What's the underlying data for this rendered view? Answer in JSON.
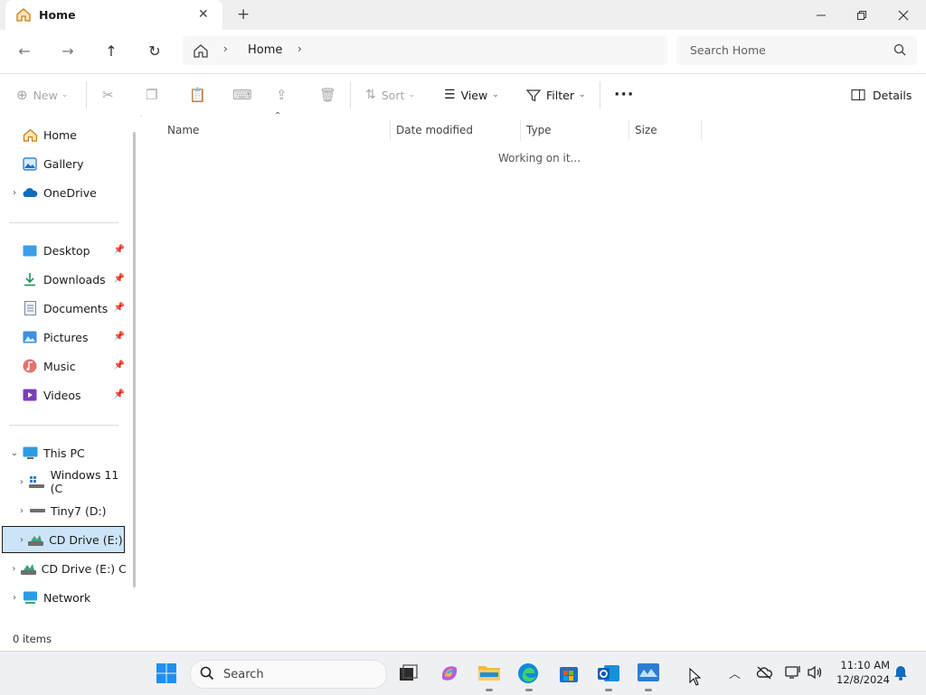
{
  "window": {
    "tab_title": "Home",
    "new_tab_icon": "plus-icon",
    "controls": [
      "minimize-icon",
      "restore-icon",
      "close-icon"
    ]
  },
  "nav": {
    "breadcrumb": [
      "Home"
    ],
    "search_placeholder": "Search Home"
  },
  "commandbar": {
    "new_label": "New",
    "sort_label": "Sort",
    "view_label": "View",
    "filter_label": "Filter",
    "details_label": "Details"
  },
  "sidebar": {
    "quick": [
      {
        "label": "Home",
        "icon": "home-icon"
      },
      {
        "label": "Gallery",
        "icon": "gallery-icon"
      },
      {
        "label": "OneDrive",
        "icon": "cloud-icon"
      }
    ],
    "pinned": [
      {
        "label": "Desktop",
        "icon": "desktop-icon"
      },
      {
        "label": "Downloads",
        "icon": "download-icon"
      },
      {
        "label": "Documents",
        "icon": "document-icon"
      },
      {
        "label": "Pictures",
        "icon": "pictures-icon"
      },
      {
        "label": "Music",
        "icon": "music-icon"
      },
      {
        "label": "Videos",
        "icon": "videos-icon"
      }
    ],
    "tree": [
      {
        "label": "This PC",
        "icon": "pc-icon"
      },
      {
        "label": "Windows 11 (C",
        "icon": "drive-icon"
      },
      {
        "label": "Tiny7 (D:)",
        "icon": "drive-icon"
      },
      {
        "label": "CD Drive (E:) C",
        "icon": "cd-drive-icon"
      },
      {
        "label": "CD Drive (E:) CC",
        "icon": "cd-drive-icon"
      },
      {
        "label": "Network",
        "icon": "network-icon"
      }
    ]
  },
  "columns": [
    "Name",
    "Date modified",
    "Type",
    "Size"
  ],
  "content_message": "Working on it...",
  "status": "0 items",
  "taskbar": {
    "search_label": "Search",
    "time": "11:10 AM",
    "date": "12/8/2024"
  },
  "colors": {
    "accent": "#0067c0",
    "selection_bg": "#cce4f7",
    "folder_yellow": "#f8c44e"
  }
}
